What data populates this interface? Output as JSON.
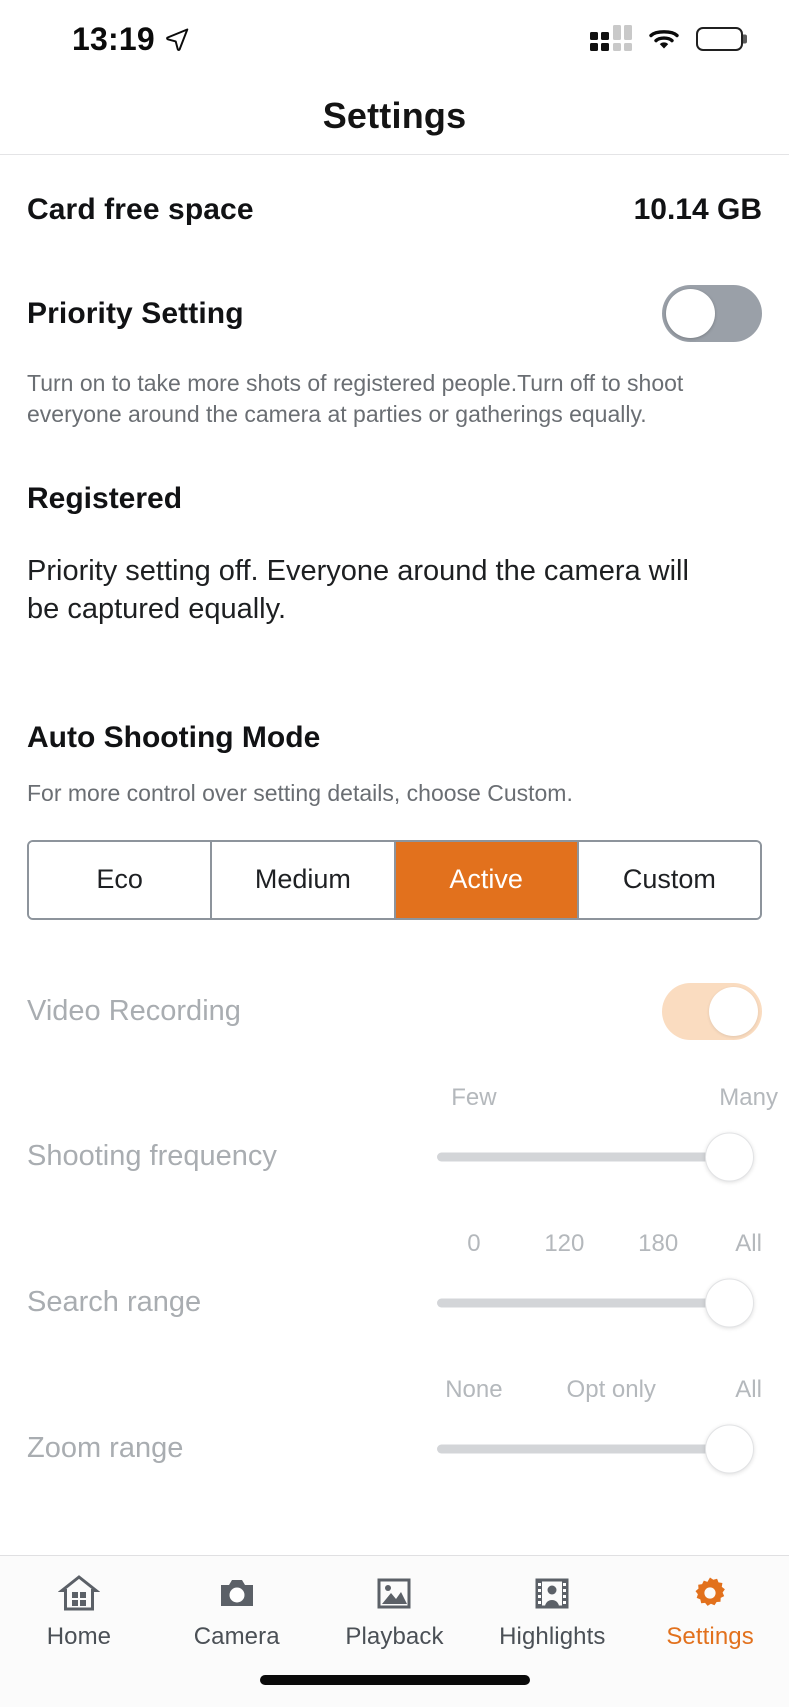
{
  "status_bar": {
    "time": "13:19",
    "location_icon": "location-arrow-icon",
    "signal_icon": "cellular-signal-icon",
    "wifi_icon": "wifi-icon",
    "battery_icon": "battery-full-icon"
  },
  "nav": {
    "title": "Settings"
  },
  "card_free_space": {
    "label": "Card free space",
    "value": "10.14 GB"
  },
  "priority_setting": {
    "label": "Priority Setting",
    "toggle_state": "off",
    "description": "Turn on to take more shots of registered people.Turn off to shoot everyone around the camera at parties or gatherings equally."
  },
  "registered": {
    "heading": "Registered",
    "body": "Priority setting off. Everyone around the camera will be captured equally."
  },
  "auto_shooting_mode": {
    "heading": "Auto Shooting Mode",
    "description": "For more control over setting details, choose Custom.",
    "options": [
      {
        "label": "Eco",
        "selected": false
      },
      {
        "label": "Medium",
        "selected": false
      },
      {
        "label": "Active",
        "selected": true
      },
      {
        "label": "Custom",
        "selected": false
      }
    ],
    "selected_option": "Active"
  },
  "video_recording": {
    "label": "Video Recording",
    "toggle_state": "on",
    "disabled": true
  },
  "sliders": [
    {
      "label": "Shooting frequency",
      "ticks": [
        "Few",
        "Many"
      ],
      "tick_positions": [
        14,
        96
      ],
      "value_position": 100,
      "disabled": true
    },
    {
      "label": "Search range",
      "ticks": [
        "0",
        "120",
        "180",
        "All"
      ],
      "tick_positions": [
        14,
        41,
        69,
        96
      ],
      "value_position": 100,
      "disabled": true
    },
    {
      "label": "Zoom range",
      "ticks": [
        "None",
        "Opt only",
        "All"
      ],
      "tick_positions": [
        14,
        55,
        96
      ],
      "value_position": 100,
      "disabled": true
    }
  ],
  "tabbar": {
    "items": [
      {
        "label": "Home",
        "icon": "home-icon",
        "selected": false
      },
      {
        "label": "Camera",
        "icon": "camera-icon",
        "selected": false
      },
      {
        "label": "Playback",
        "icon": "photo-icon",
        "selected": false
      },
      {
        "label": "Highlights",
        "icon": "film-portrait-icon",
        "selected": false
      },
      {
        "label": "Settings",
        "icon": "gear-icon",
        "selected": true
      }
    ]
  },
  "colors": {
    "accent": "#e2711d",
    "accent_soft": "#fadcc0",
    "toggle_off": "#9aa0a8",
    "muted_text": "#a9adb1",
    "body_text": "#111214"
  }
}
